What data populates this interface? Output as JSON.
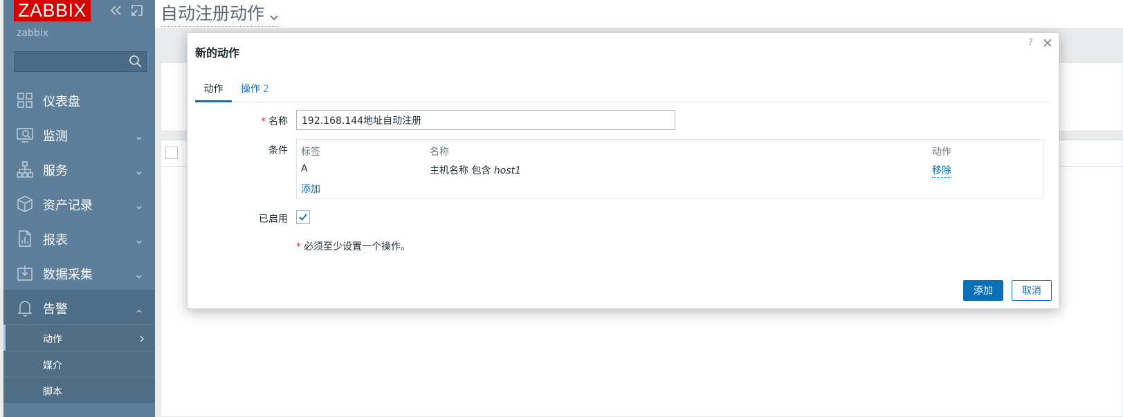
{
  "app": {
    "logo": "ZABBIX",
    "server_name": "zabbix",
    "page_title": "自动注册动作"
  },
  "sidebar": {
    "search_placeholder": "",
    "items": [
      {
        "label": "仪表盘",
        "icon": "dashboard-icon",
        "expandable": false
      },
      {
        "label": "监测",
        "icon": "monitoring-icon",
        "expandable": true
      },
      {
        "label": "服务",
        "icon": "services-icon",
        "expandable": true
      },
      {
        "label": "资产记录",
        "icon": "inventory-icon",
        "expandable": true
      },
      {
        "label": "报表",
        "icon": "reports-icon",
        "expandable": true
      },
      {
        "label": "数据采集",
        "icon": "data-collection-icon",
        "expandable": true
      },
      {
        "label": "告警",
        "icon": "alerts-icon",
        "expandable": true,
        "expanded": true
      }
    ],
    "alerts_submenu": [
      {
        "label": "动作",
        "selected": true
      },
      {
        "label": "媒介",
        "selected": false
      },
      {
        "label": "脚本",
        "selected": false
      }
    ]
  },
  "modal": {
    "title": "新的动作",
    "help": "?",
    "tabs": [
      {
        "label": "动作",
        "active": true
      },
      {
        "label": "操作",
        "count": "2",
        "active": false
      }
    ],
    "form": {
      "name_label": "名称",
      "name_value": "192.168.144地址自动注册",
      "conditions_label": "条件",
      "enabled_label": "已启用",
      "enabled": true,
      "note": "必须至少设置一个操作。"
    },
    "conditions": {
      "headers": {
        "tag": "标签",
        "name": "名称",
        "action": "动作"
      },
      "rows": [
        {
          "tag": "A",
          "name_prefix": "主机名称 包含 ",
          "name_value": "host1",
          "action": "移除"
        }
      ],
      "add_link": "添加"
    },
    "buttons": {
      "add": "添加",
      "cancel": "取消"
    }
  },
  "colors": {
    "sidebar_bg": "#5d7f9a",
    "logo_bg": "#d40000",
    "primary": "#0a6fb6",
    "required": "#e33734"
  }
}
